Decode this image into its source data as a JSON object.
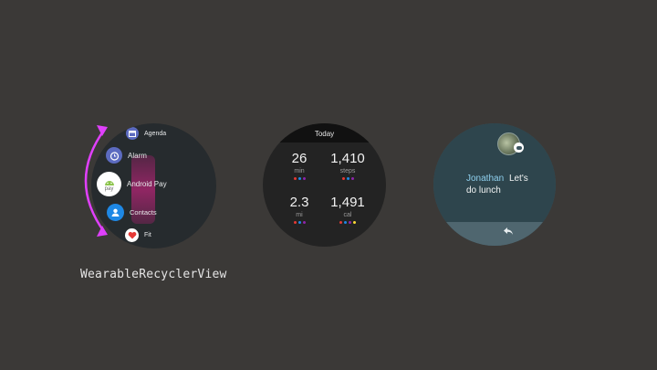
{
  "list_watch": {
    "items": [
      {
        "label": "Agenda",
        "icon": "calendar-icon",
        "color": "#5c6bc0"
      },
      {
        "label": "Alarm",
        "icon": "alarm-clock-icon",
        "color": "#5c6bc0"
      },
      {
        "label": "Android Pay",
        "icon": "android-pay-icon",
        "color": "#ffffff"
      },
      {
        "label": "Contacts",
        "icon": "contacts-icon",
        "color": "#1e88e5"
      },
      {
        "label": "Fit",
        "icon": "heart-icon",
        "color": "#ffffff"
      }
    ],
    "caption": "WearableRecyclerView",
    "arc_color": "#e040fb"
  },
  "stats_watch": {
    "header": "Today",
    "stats": [
      {
        "value": "26",
        "unit": "min"
      },
      {
        "value": "1,410",
        "unit": "steps"
      },
      {
        "value": "2.3",
        "unit": "mi"
      },
      {
        "value": "1,491",
        "unit": "cal"
      }
    ],
    "dot_colors": [
      "#e53935",
      "#1e88e5",
      "#8e24aa",
      "#fdd835"
    ]
  },
  "notification_watch": {
    "sender": "Jonathan",
    "message": "Let's do lunch",
    "action_icon": "reply-icon"
  }
}
